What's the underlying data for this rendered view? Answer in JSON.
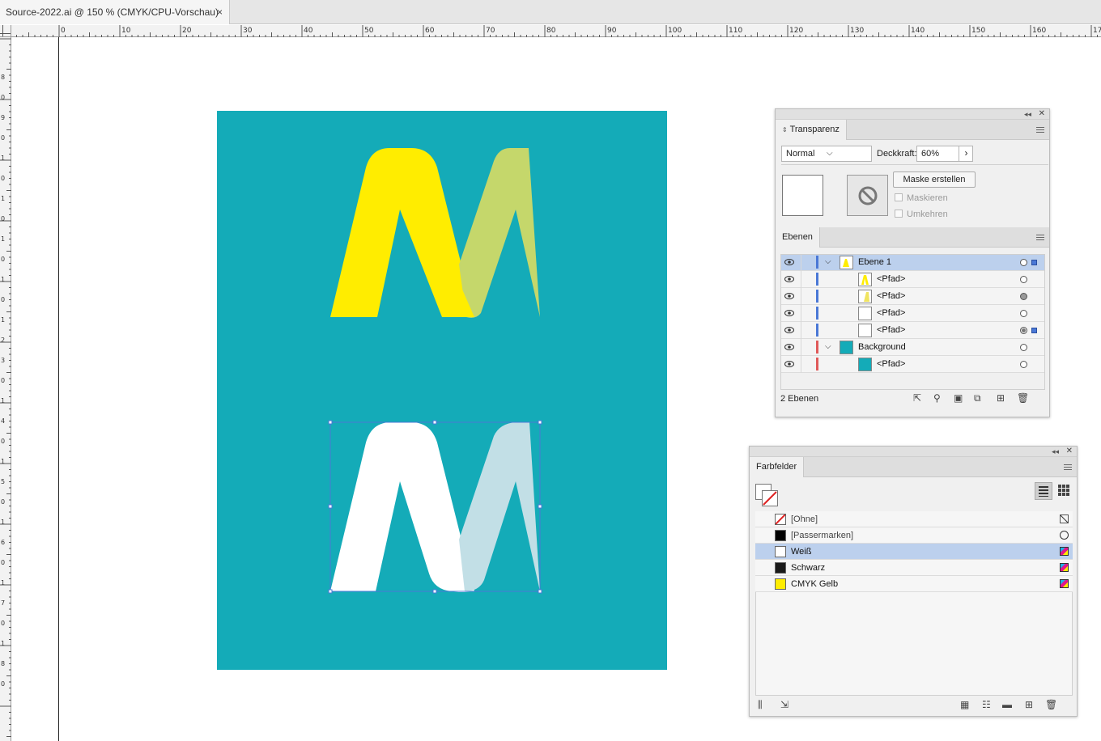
{
  "document": {
    "tab_title": "Source-2022.ai @ 150 % (CMYK/CPU-Vorschau)",
    "close_glyph": "×"
  },
  "ruler": {
    "h_labels": [
      "0",
      "10",
      "20",
      "30",
      "40",
      "50",
      "60",
      "70",
      "80",
      "90",
      "100",
      "110",
      "120",
      "130",
      "140",
      "150",
      "160",
      "17"
    ],
    "v_labels": [
      "8",
      "0",
      "9",
      "0",
      "1",
      "0",
      "1",
      "0",
      "1",
      "0",
      "1",
      "0",
      "1",
      "2",
      "3",
      "0",
      "1",
      "4",
      "0",
      "1",
      "5",
      "0",
      "1",
      "6",
      "0",
      "1",
      "7",
      "0",
      "1",
      "8",
      "0"
    ]
  },
  "colors": {
    "artboard": "#14abb8",
    "yellow": "#ffed00",
    "olive_overlap": "#c5d76b",
    "white": "#ffffff",
    "light_blue": "#c2dfe6",
    "selection": "#4a78d6",
    "row_selected": "#bcd0ed"
  },
  "transparenz": {
    "tab": "Transparenz",
    "blend_mode": "Normal",
    "opacity_label": "Deckkraft:",
    "opacity_value": "60%",
    "mask_button": "Maske erstellen",
    "clip_label": "Maskieren",
    "invert_label": "Umkehren"
  },
  "ebenen": {
    "tab": "Ebenen",
    "layers": [
      {
        "name": "Ebene 1"
      },
      {
        "name": "<Pfad>"
      },
      {
        "name": "<Pfad>"
      },
      {
        "name": "<Pfad>"
      },
      {
        "name": "<Pfad>"
      },
      {
        "name": "Background"
      },
      {
        "name": "<Pfad>"
      }
    ],
    "footer_count": "2 Ebenen"
  },
  "farbfelder": {
    "tab": "Farbfelder",
    "swatches": [
      {
        "name": "[Ohne]",
        "color": "none"
      },
      {
        "name": "[Passermarken]",
        "color": "#000000"
      },
      {
        "name": "Weiß",
        "color": "#ffffff"
      },
      {
        "name": "Schwarz",
        "color": "#1a1a1a"
      },
      {
        "name": "CMYK Gelb",
        "color": "#ffed00"
      }
    ]
  }
}
